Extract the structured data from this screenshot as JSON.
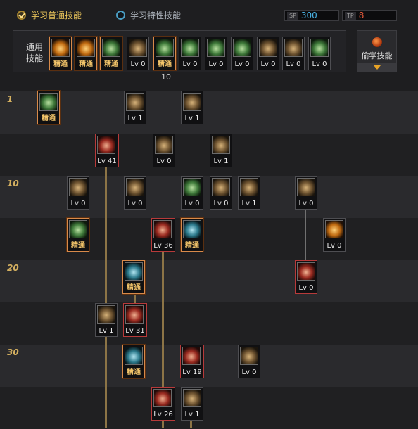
{
  "tabs": [
    {
      "label": "学习普通技能",
      "active": true
    },
    {
      "label": "学习特性技能",
      "active": false
    }
  ],
  "points": {
    "sp": {
      "tag": "SP",
      "value": "300",
      "color": "#4ab3e6"
    },
    "tp": {
      "tag": "TP",
      "value": "8",
      "color": "#e85a3a"
    }
  },
  "common_label_1": "通用",
  "common_label_2": "技能",
  "common_skills": [
    "精通",
    "精通",
    "精通",
    "Lv 0",
    "精通",
    "Lv 0",
    "Lv 0",
    "Lv 0",
    "Lv 0",
    "Lv 0",
    "Lv 0"
  ],
  "common_extra_number": "10",
  "steal": {
    "label": "偷学技能"
  },
  "row_levels": {
    "r1": "1",
    "r10": "10",
    "r20": "20",
    "r30": "30"
  },
  "tree": [
    [
      "精通",
      "Lv 1",
      "Lv 1"
    ],
    [
      "Lv 41",
      "Lv 0",
      "Lv 1"
    ],
    [
      "Lv 0",
      "Lv 0",
      "Lv 0",
      "Lv 0",
      "Lv 1",
      "Lv 0"
    ],
    [
      "精通",
      "Lv 36",
      "精通",
      "Lv 0"
    ],
    [
      "精通",
      "Lv 0"
    ],
    [
      "Lv 1",
      "Lv 31"
    ],
    [
      "精通",
      "Lv 19",
      "Lv 0"
    ],
    [
      "Lv 26",
      "Lv 1"
    ]
  ]
}
